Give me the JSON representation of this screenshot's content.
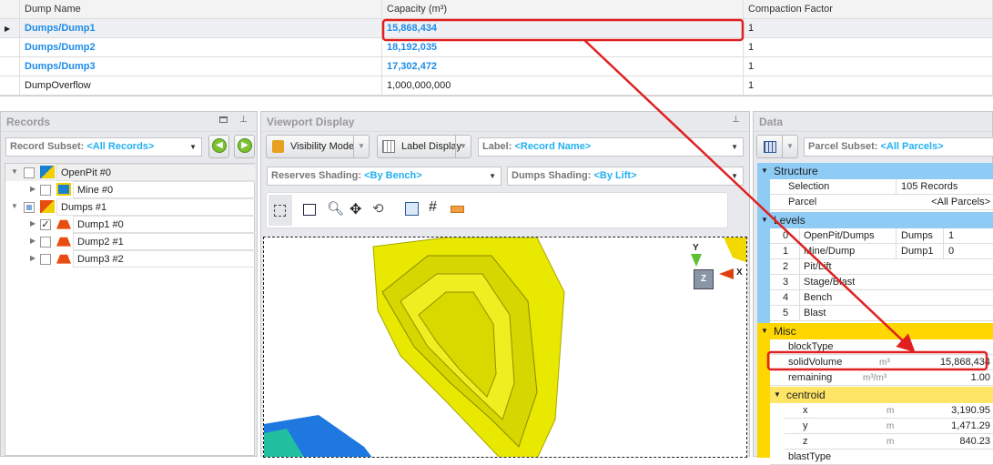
{
  "grid": {
    "headers": [
      "Dump Name",
      "Capacity (m³)",
      "Compaction Factor"
    ],
    "rows": [
      {
        "name": "Dumps/Dump1",
        "capacity": "15,868,434",
        "factor": "1"
      },
      {
        "name": "Dumps/Dump2",
        "capacity": "18,192,035",
        "factor": "1"
      },
      {
        "name": "Dumps/Dump3",
        "capacity": "17,302,472",
        "factor": "1"
      },
      {
        "name": "DumpOverflow",
        "capacity": "1,000,000,000",
        "factor": "1"
      }
    ]
  },
  "records": {
    "title": "Records",
    "subset_label": "Record Subset:",
    "subset_value": "<All Records>",
    "tree": [
      {
        "label": "OpenPit #0"
      },
      {
        "label": "Mine #0"
      },
      {
        "label": "Dumps #1"
      },
      {
        "label": "Dump1 #0"
      },
      {
        "label": "Dump2 #1"
      },
      {
        "label": "Dump3 #2"
      }
    ]
  },
  "viewport": {
    "title": "Viewport Display",
    "visibility": "Visibility Mode",
    "label_display": "Label Display",
    "label_key": "Label:",
    "label_value": "<Record Name>",
    "reserves_key": "Reserves Shading:",
    "reserves_value": "<By Bench>",
    "dumps_key": "Dumps Shading:",
    "dumps_value": "<By Lift>",
    "axes": {
      "y": "Y",
      "x": "X",
      "z": "Z"
    }
  },
  "data": {
    "title": "Data",
    "parcel_key": "Parcel Subset:",
    "parcel_value": "<All Parcels>",
    "structure": {
      "title": "Structure",
      "selection_label": "Selection",
      "selection_value": "105 Records",
      "parcel_label": "Parcel",
      "parcel_value": "<All Parcels>"
    },
    "levels": {
      "title": "Levels",
      "rows": [
        {
          "n": "0",
          "name": "OpenPit/Dumps",
          "v1": "Dumps",
          "v2": "1"
        },
        {
          "n": "1",
          "name": "Mine/Dump",
          "v1": "Dump1",
          "v2": "0"
        },
        {
          "n": "2",
          "name": "Pit/Lift",
          "v1": "",
          "v2": ""
        },
        {
          "n": "3",
          "name": "Stage/Blast",
          "v1": "",
          "v2": ""
        },
        {
          "n": "4",
          "name": "Bench",
          "v1": "",
          "v2": ""
        },
        {
          "n": "5",
          "name": "Blast",
          "v1": "",
          "v2": ""
        }
      ]
    },
    "misc": {
      "title": "Misc",
      "blockType": "blockType",
      "solidVolume": "solidVolume",
      "solidVolume_unit": "m³",
      "solidVolume_value": "15,868,434",
      "remaining": "remaining",
      "remaining_unit": "m³/m³",
      "remaining_value": "1.00",
      "centroid": "centroid",
      "centroid_rows": [
        {
          "k": "x",
          "u": "m",
          "v": "3,190.95"
        },
        {
          "k": "y",
          "u": "m",
          "v": "1,471.29"
        },
        {
          "k": "z",
          "u": "m",
          "v": "840.23"
        }
      ],
      "blastType": "blastType"
    }
  },
  "colors": {
    "accent": "#1e8ce8",
    "annotation": "#e02020",
    "structure": "#8ecbf5",
    "misc": "#ffd700"
  }
}
